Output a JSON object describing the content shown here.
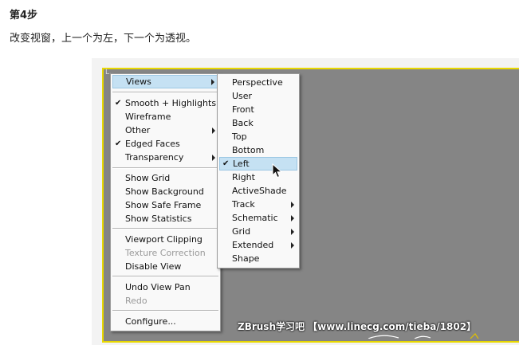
{
  "step": {
    "title": "第4步"
  },
  "instruction": "改变视窗，上一个为左，下一个为透视。",
  "viewport": {
    "corner_label": "L.."
  },
  "watermark": "ZBrush学习吧 【www.linecg.com/tieba/1802】",
  "main_menu": {
    "views": "Views",
    "smooth_highlights": "Smooth + Highlights",
    "wireframe": "Wireframe",
    "other": "Other",
    "edged_faces": "Edged Faces",
    "transparency": "Transparency",
    "show_grid": "Show Grid",
    "show_background": "Show Background",
    "show_safe_frame": "Show Safe Frame",
    "show_statistics": "Show Statistics",
    "viewport_clipping": "Viewport Clipping",
    "texture_correction": "Texture Correction",
    "disable_view": "Disable View",
    "undo_view_pan": "Undo View Pan",
    "redo": "Redo",
    "configure": "Configure..."
  },
  "views_submenu": {
    "perspective": "Perspective",
    "user": "User",
    "front": "Front",
    "back": "Back",
    "top": "Top",
    "bottom": "Bottom",
    "left": "Left",
    "right": "Right",
    "activeshade": "ActiveShade",
    "track": "Track",
    "schematic": "Schematic",
    "grid": "Grid",
    "extended": "Extended",
    "shape": "Shape"
  },
  "colors": {
    "viewport_bg": "#858585",
    "viewport_border": "#e8d800",
    "menu_highlight": "#c5e1f3"
  }
}
